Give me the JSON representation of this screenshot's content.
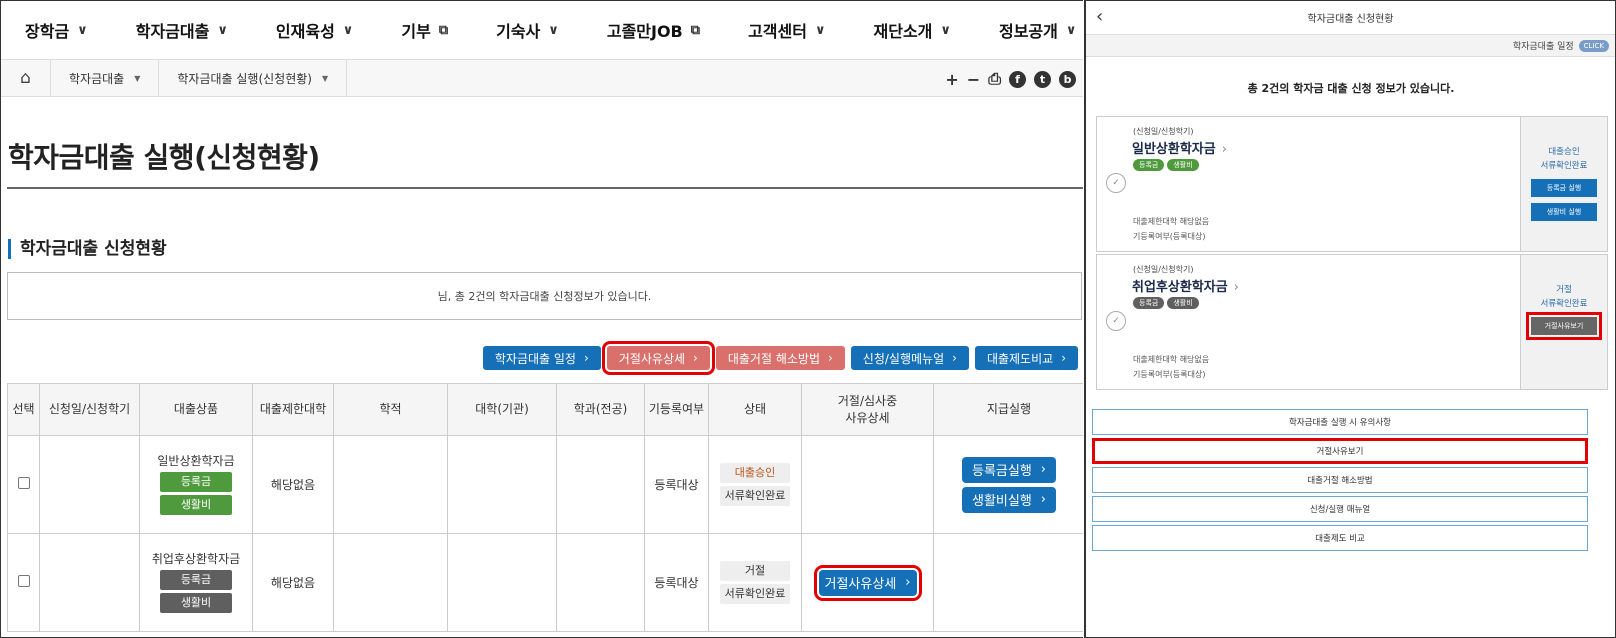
{
  "gnb": [
    {
      "label": "장학금",
      "icon": "chevron-down-icon",
      "glyph": "∨"
    },
    {
      "label": "학자금대출",
      "icon": "chevron-down-icon",
      "glyph": "∨"
    },
    {
      "label": "인재육성",
      "icon": "chevron-down-icon",
      "glyph": "∨"
    },
    {
      "label": "기부",
      "icon": "external-link-icon",
      "glyph": "⧉"
    },
    {
      "label": "기숙사",
      "icon": "chevron-down-icon",
      "glyph": "∨"
    },
    {
      "label": "고졸만JOB",
      "icon": "external-link-icon",
      "glyph": "⧉"
    },
    {
      "label": "고객센터",
      "icon": "chevron-down-icon",
      "glyph": "∨"
    },
    {
      "label": "재단소개",
      "icon": "chevron-down-icon",
      "glyph": "∨"
    },
    {
      "label": "정보공개",
      "icon": "chevron-down-icon",
      "glyph": "∨"
    }
  ],
  "breadcrumb": {
    "items": [
      "학자금대출",
      "학자금대출 실행(신청현황)"
    ]
  },
  "tools": {
    "plus": "+",
    "minus": "−",
    "print": "⎙",
    "facebook": "f",
    "twitter": "t",
    "blog": "b"
  },
  "page": {
    "title": "학자금대출 실행(신청현황)",
    "section": "학자금대출 신청현황",
    "notice": "님, 총 2건의 학자금대출 신청정보가 있습니다."
  },
  "buttons": [
    {
      "label": "학자금대출 일정",
      "style": "blue",
      "highlight": false
    },
    {
      "label": "거절사유상세",
      "style": "red",
      "highlight": true
    },
    {
      "label": "대출거절 해소방법",
      "style": "red",
      "highlight": false
    },
    {
      "label": "신청/실행메뉴얼",
      "style": "blue",
      "highlight": false
    },
    {
      "label": "대출제도비교",
      "style": "blue",
      "highlight": false
    }
  ],
  "table": {
    "headers": [
      "선택",
      "신청일/신청학기",
      "대출상품",
      "대출제한대학",
      "학적",
      "대학(기관)",
      "학과(전공)",
      "기등록여부",
      "상태",
      "거절/심사중\n사유상세",
      "지급실행"
    ],
    "rows": [
      {
        "product": "일반상환학자금",
        "tags": [
          "등록금",
          "생활비"
        ],
        "tag_color": "#4e9a3c",
        "restrict": "해당없음",
        "registered": "등록대상",
        "status": [
          "대출승인",
          "서류확인완료"
        ],
        "reason": "",
        "pay": [
          "등록금실행",
          "생활비실행"
        ]
      },
      {
        "product": "취업후상환학자금",
        "tags": [
          "등록금",
          "생활비"
        ],
        "tag_color": "#5f5f5f",
        "restrict": "해당없음",
        "registered": "등록대상",
        "status": [
          "거절",
          "서류확인완료"
        ],
        "reason": "거절사유상세",
        "pay": []
      }
    ]
  },
  "mobile": {
    "header": "학자금대출 신청현황",
    "schedule_label": "학자금대출 일정",
    "click": "CLICK",
    "count_text": "총 2건의 학자금 대출 신청 정보가 있습니다.",
    "cards": [
      {
        "date": "(신청일/신청학기)",
        "name": "일반상환학자금",
        "tags": [
          "등록금",
          "생활비"
        ],
        "tag_color": "#4e9a3c",
        "info1": "대출제한대학 해당없음",
        "info2": "기등록여부(등록대상)",
        "status1": "대출승인",
        "status2": "서류확인완료",
        "buttons": [
          "등록금 실행",
          "생활비 실행"
        ]
      },
      {
        "date": "(신청일/신청학기)",
        "name": "취업후상환학자금",
        "tags": [
          "등록금",
          "생활비"
        ],
        "tag_color": "#5f5f5f",
        "info1": "대출제한대학 해당없음",
        "info2": "기등록여부(등록대상)",
        "status1": "거절",
        "status2": "서류확인완료",
        "buttons": [
          "거절사유보기"
        ]
      }
    ],
    "links": [
      "학자금대출 실행 시 유의사항",
      "거절사유보기",
      "대출거절 해소방법",
      "신청/실행 매뉴얼",
      "대출제도 비교"
    ]
  },
  "colors": {
    "primary": "#1570b8",
    "danger": "#d9706b",
    "highlight": "#e30000"
  }
}
